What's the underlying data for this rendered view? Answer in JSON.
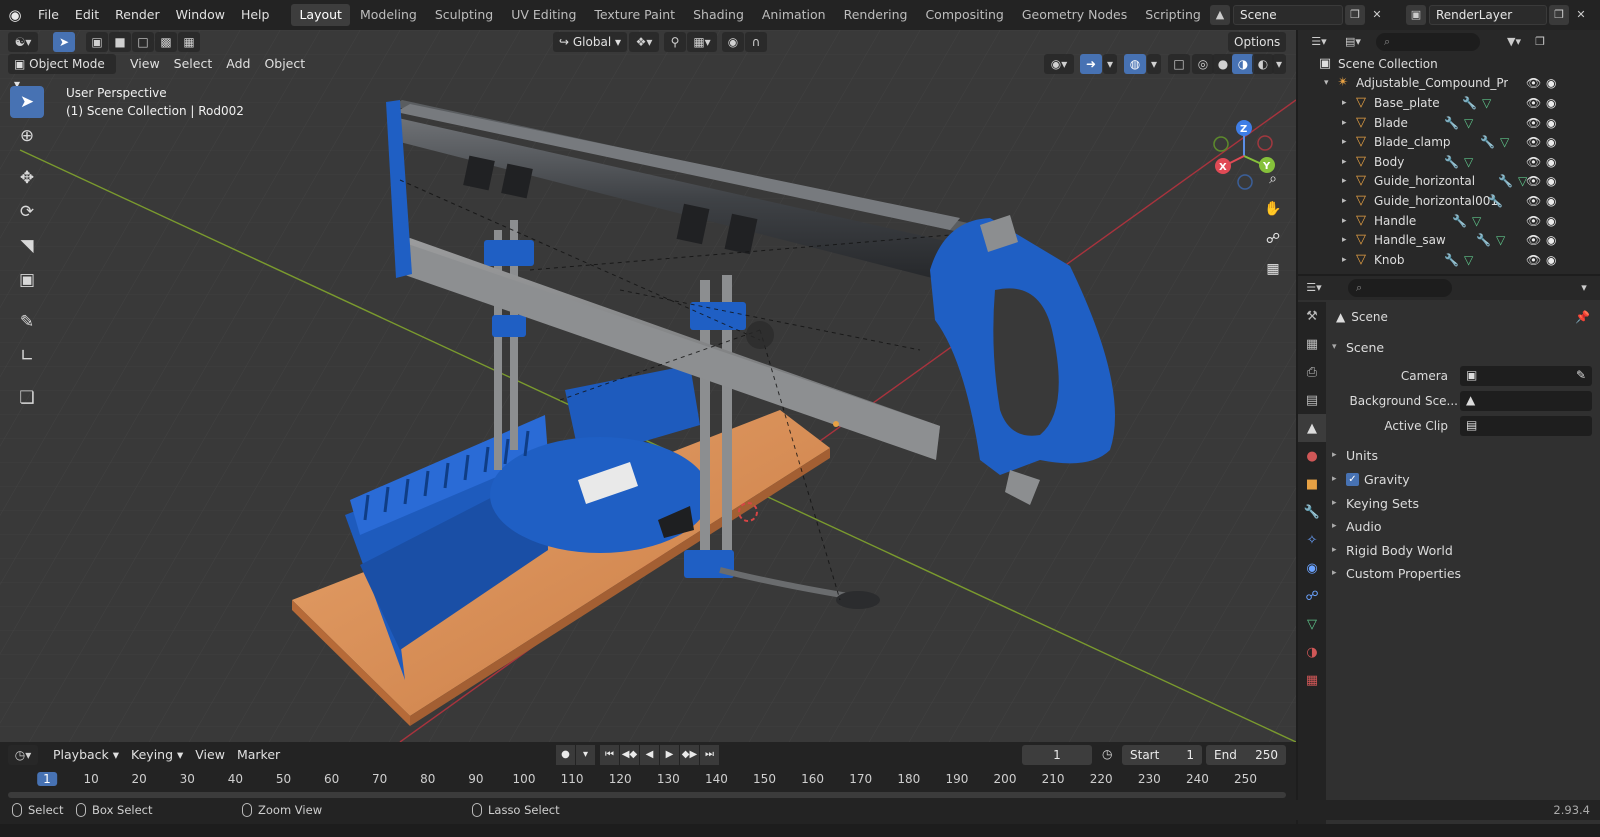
{
  "menu": [
    "File",
    "Edit",
    "Render",
    "Window",
    "Help"
  ],
  "workspaces": [
    "Layout",
    "Modeling",
    "Sculpting",
    "UV Editing",
    "Texture Paint",
    "Shading",
    "Animation",
    "Rendering",
    "Compositing",
    "Geometry Nodes",
    "Scripting"
  ],
  "scene_name": "Scene",
  "render_layer": "RenderLayer",
  "viewport": {
    "mode": "Object Mode",
    "menus": [
      "View",
      "Select",
      "Add",
      "Object"
    ],
    "transform_orientation": "Global",
    "options_label": "Options",
    "perspective_label": "User Perspective",
    "collection_label": "(1) Scene Collection | Rod002",
    "gizmo_axes": {
      "x": "X",
      "y": "Y",
      "z": "Z"
    }
  },
  "outliner": {
    "root": "Scene Collection",
    "collection": "Adjustable_Compound_Precis",
    "objects": [
      "Base_plate",
      "Blade",
      "Blade_clamp",
      "Body",
      "Guide_horizontal",
      "Guide_horizontal001",
      "Handle",
      "Handle_saw",
      "Knob"
    ]
  },
  "properties": {
    "header": "Scene",
    "panel": "Scene",
    "camera_label": "Camera",
    "background_label": "Background Sce...",
    "active_clip_label": "Active Clip",
    "subpanels": [
      "Units",
      "Gravity",
      "Keying Sets",
      "Audio",
      "Rigid Body World",
      "Custom Properties"
    ],
    "gravity_checked": true
  },
  "timeline": {
    "menus": [
      "Playback",
      "Keying",
      "View",
      "Marker"
    ],
    "current_frame": "1",
    "start_label": "Start",
    "start": "1",
    "end_label": "End",
    "end": "250",
    "ruler": [
      "1",
      "10",
      "20",
      "30",
      "40",
      "50",
      "60",
      "70",
      "80",
      "90",
      "100",
      "110",
      "120",
      "130",
      "140",
      "150",
      "160",
      "170",
      "180",
      "190",
      "200",
      "210",
      "220",
      "230",
      "240",
      "250"
    ]
  },
  "status": {
    "select": "Select",
    "box_select": "Box Select",
    "zoom_view": "Zoom View",
    "lasso_select": "Lasso Select",
    "version": "2.93.4"
  },
  "colors": {
    "accent": "#4772b3",
    "object_orange": "#e7a144",
    "saw_blue": "#1f5fc4",
    "wood": "#d98a4e"
  }
}
